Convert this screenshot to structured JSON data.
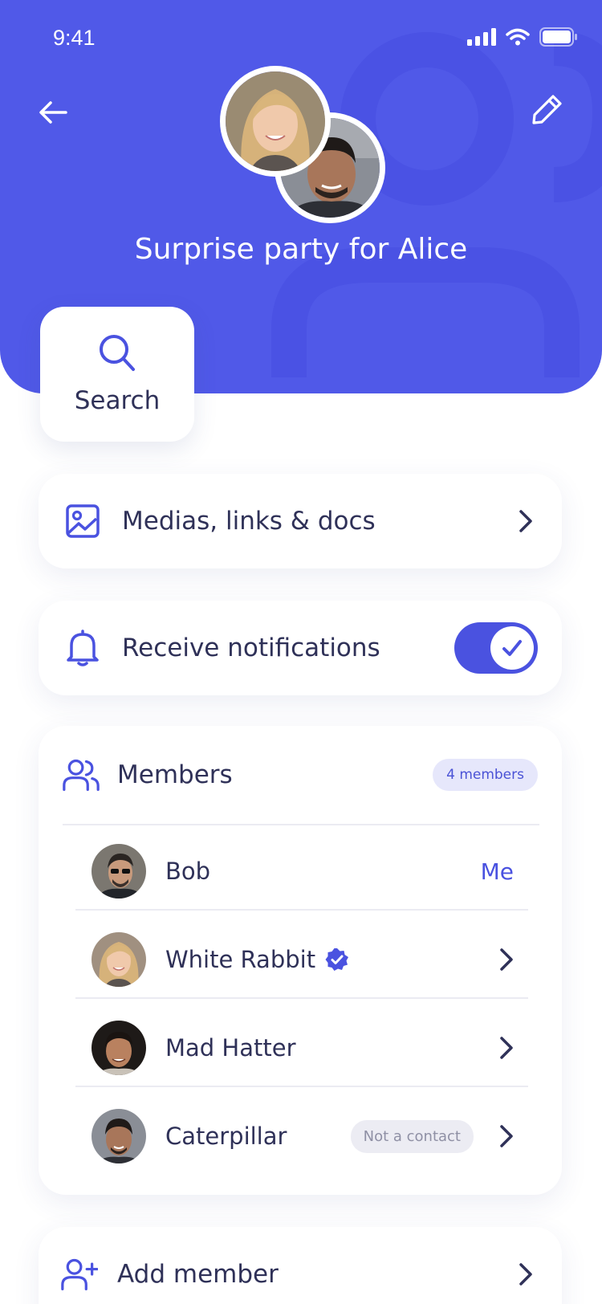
{
  "status_bar": {
    "time": "9:41"
  },
  "header": {
    "group_name": "Surprise party for Alice",
    "background_color": "#5059e8"
  },
  "quick_actions": {
    "search_label": "Search"
  },
  "settings": {
    "media_label": "Medias, links & docs",
    "notifications_label": "Receive notifications",
    "notifications_enabled": true
  },
  "members": {
    "title": "Members",
    "count_badge": "4 members",
    "list": [
      {
        "name": "Bob",
        "tag": "Me",
        "verified": false,
        "not_contact": ""
      },
      {
        "name": "White Rabbit",
        "tag": "",
        "verified": true,
        "not_contact": ""
      },
      {
        "name": "Mad Hatter",
        "tag": "",
        "verified": false,
        "not_contact": ""
      },
      {
        "name": "Caterpillar",
        "tag": "",
        "verified": false,
        "not_contact": "Not a contact"
      }
    ]
  },
  "add_member": {
    "label": "Add member"
  },
  "colors": {
    "accent": "#4a52e0",
    "text": "#2f3158",
    "badge_bg": "#e6e7fb"
  }
}
